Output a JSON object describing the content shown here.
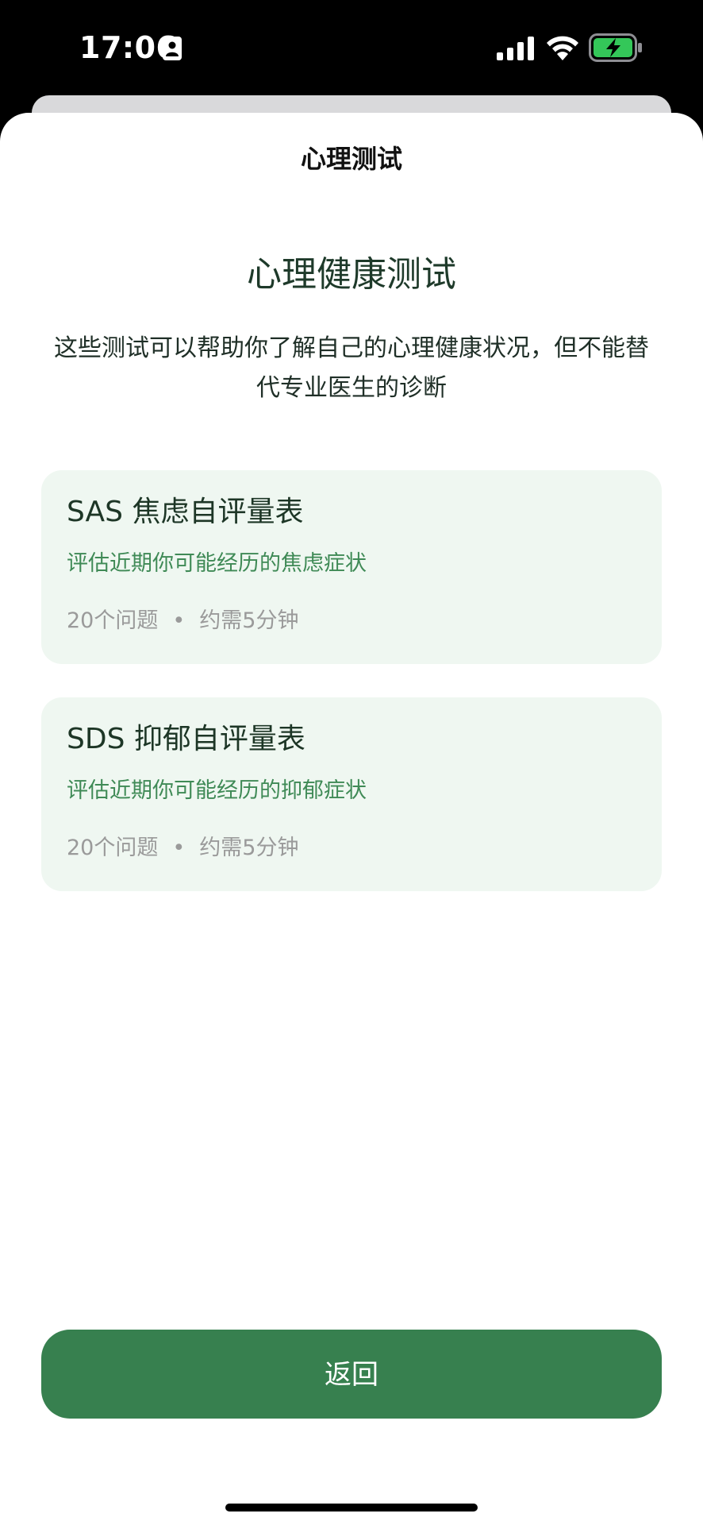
{
  "status_bar": {
    "time": "17:06",
    "icons": [
      "id-card-icon",
      "signal-icon",
      "wifi-icon",
      "battery-charging-icon"
    ],
    "battery_color": "#34c759"
  },
  "nav": {
    "title": "心理测试"
  },
  "main": {
    "heading": "心理健康测试",
    "description": "这些测试可以帮助你了解自己的心理健康状况，但不能替代专业医生的诊断",
    "tests": [
      {
        "title": "SAS 焦虑自评量表",
        "description": "评估近期你可能经历的焦虑症状",
        "questions": "20个问题",
        "separator": "•",
        "duration": "约需5分钟"
      },
      {
        "title": "SDS 抑郁自评量表",
        "description": "评估近期你可能经历的抑郁症状",
        "questions": "20个问题",
        "separator": "•",
        "duration": "约需5分钟"
      }
    ]
  },
  "footer": {
    "back_label": "返回"
  },
  "colors": {
    "accent": "#37804f",
    "card_bg": "#eff7f1",
    "card_desc": "#3f8a56",
    "meta": "#9a9a9a"
  }
}
